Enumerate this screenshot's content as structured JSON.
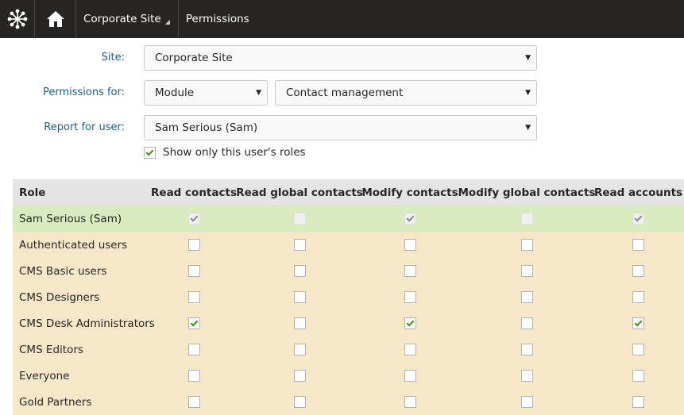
{
  "topbar": {
    "site_label": "Corporate Site",
    "app_label": "Permissions"
  },
  "form": {
    "site": {
      "label": "Site:",
      "value": "Corporate Site"
    },
    "permissions_for": {
      "label": "Permissions for:",
      "type_value": "Module",
      "module_value": "Contact management"
    },
    "report_for_user": {
      "label": "Report for user:",
      "value": "Sam Serious (Sam)"
    },
    "show_only": {
      "label": "Show only this user's roles",
      "checked": true
    }
  },
  "table": {
    "headers": [
      "Role",
      "Read contacts",
      "Read global contacts",
      "Modify contacts",
      "Modify global contacts",
      "Read accounts"
    ],
    "rows": [
      {
        "role": "Sam Serious (Sam)",
        "states": [
          "disabled-checked",
          "disabled",
          "disabled-checked",
          "disabled",
          "disabled-checked"
        ]
      },
      {
        "role": "Authenticated users",
        "states": [
          "off",
          "off",
          "off",
          "off",
          "off"
        ]
      },
      {
        "role": "CMS Basic users",
        "states": [
          "off",
          "off",
          "off",
          "off",
          "off"
        ]
      },
      {
        "role": "CMS Designers",
        "states": [
          "off",
          "off",
          "off",
          "off",
          "off"
        ]
      },
      {
        "role": "CMS Desk Administrators",
        "states": [
          "on",
          "off",
          "on",
          "off",
          "on"
        ]
      },
      {
        "role": "CMS Editors",
        "states": [
          "off",
          "off",
          "off",
          "off",
          "off"
        ]
      },
      {
        "role": "Everyone",
        "states": [
          "off",
          "off",
          "off",
          "off",
          "off"
        ]
      },
      {
        "role": "Gold Partners",
        "states": [
          "off",
          "off",
          "off",
          "off",
          "off"
        ]
      }
    ]
  },
  "colors": {
    "topbar_bg": "#262524",
    "label_blue": "#1f5d92",
    "header_row_bg": "#e5e5e5",
    "user_row_bg": "#d8ecc0",
    "role_row_bg": "#f5e7c8",
    "check_green": "#4a8a1c"
  },
  "icons": {
    "logo": "kentico-logo-icon",
    "home": "home-icon",
    "dropdown": "dropdown-arrow-icon"
  }
}
